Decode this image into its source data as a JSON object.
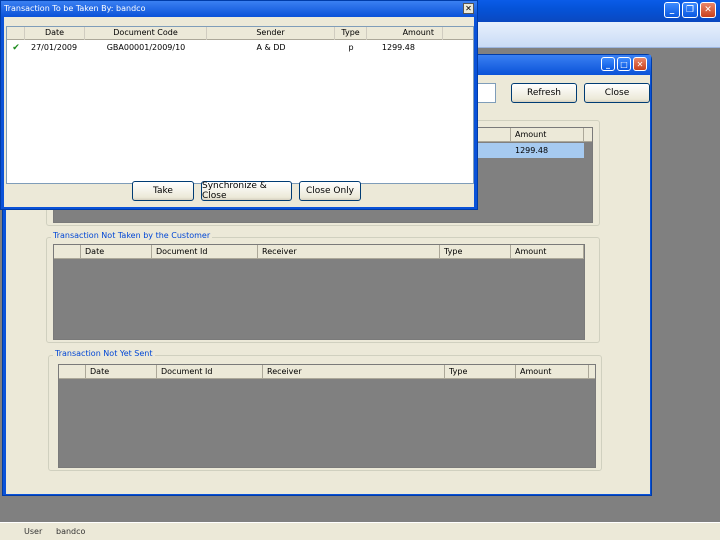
{
  "status_bar": {
    "user_label": "User",
    "user_value": "bandco"
  },
  "child_window": {
    "refresh_button": "Refresh",
    "close_button": "Close",
    "groups": [
      {
        "title": "",
        "columns": [
          "Amount"
        ],
        "rows": [
          {
            "amount": "1299.48"
          }
        ]
      },
      {
        "title": "Transaction Not Taken by the Customer",
        "columns": [
          "Date",
          "Document Id",
          "Receiver",
          "Type",
          "Amount"
        ],
        "rows": []
      },
      {
        "title": "Transaction Not Yet Sent",
        "columns": [
          "Date",
          "Document Id",
          "Receiver",
          "Type",
          "Amount"
        ],
        "rows": []
      }
    ]
  },
  "dialog": {
    "title": "Transaction To be Taken By: bandco",
    "close_glyph": "✕",
    "columns": [
      "Date",
      "Document Code",
      "Sender",
      "Type",
      "Amount"
    ],
    "rows": [
      {
        "checked": true,
        "date": "27/01/2009",
        "document_code": "GBA00001/2009/10",
        "sender": "A & DD",
        "type": "p",
        "amount": "1299.48"
      }
    ],
    "buttons": {
      "take": "Take",
      "synchronize_close": "Synchronize & Close",
      "close_only": "Close Only"
    }
  },
  "colors": {
    "title_blue": "#0a52d8",
    "group_title": "#0046d5",
    "selection": "#a6caf0",
    "window_bg": "#ece9d8",
    "grid_bg": "#808080"
  },
  "icons": {
    "window_controls": [
      "minimize-icon",
      "restore-icon",
      "close-icon"
    ],
    "row_check": "checkmark-icon"
  }
}
